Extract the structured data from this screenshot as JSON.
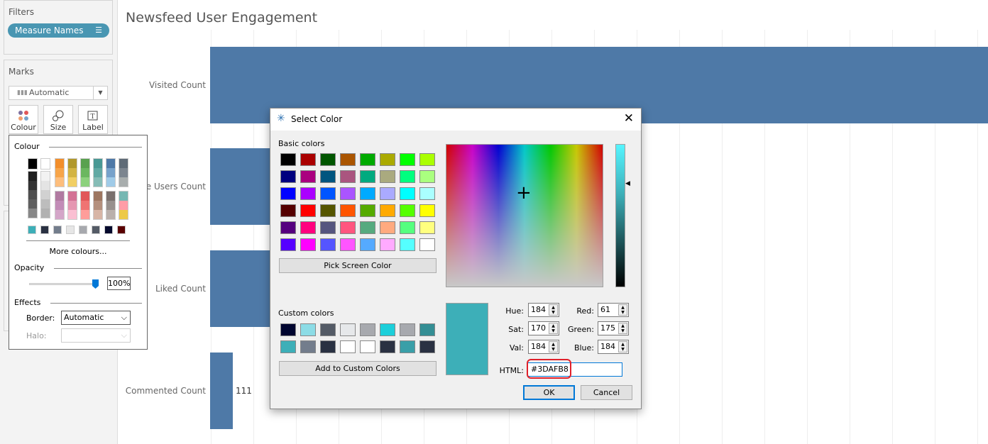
{
  "filters": {
    "title": "Filters",
    "pill": "Measure Names",
    "pill_icon": "sort-icon"
  },
  "marks": {
    "title": "Marks",
    "type": "Automatic",
    "buttons": [
      {
        "label": "Colour",
        "icon": "colour-dots-icon"
      },
      {
        "label": "Size",
        "icon": "size-icon"
      },
      {
        "label": "Label",
        "icon": "label-icon"
      }
    ]
  },
  "colour_popup": {
    "title": "Colour",
    "more": "More colours...",
    "opacity_title": "Opacity",
    "opacity_value": "100%",
    "opacity_level": 100,
    "effects_title": "Effects",
    "border_label": "Border:",
    "border_value": "Automatic",
    "halo_label": "Halo:",
    "halo_value": "",
    "top_columns": [
      [
        "#000000"
      ],
      [
        "#ffffff"
      ],
      [
        "#f28e2b",
        "#f7a54a",
        "#fdbe7d"
      ],
      [
        "#b1982c",
        "#d3b443",
        "#f1cf64"
      ],
      [
        "#59a14f",
        "#6bb760",
        "#8cd17d"
      ],
      [
        "#499894",
        "#62a9a4",
        "#86bcb6"
      ],
      [
        "#4e79a7",
        "#77a2cb",
        "#a0cbe8"
      ],
      [
        "#5f6b77",
        "#7c858f",
        "#a8adad"
      ]
    ],
    "gray_columns": [
      [
        "#1f1f1f",
        "#333333",
        "#4f4f4f",
        "#5f5f5f",
        "#878787"
      ],
      [
        "#f2f2f2",
        "#e4e4e4",
        "#d1d1d1",
        "#bdbdbd",
        "#b1b1b1"
      ]
    ],
    "mid_columns": [
      [
        "#b07aa1",
        "#c28cb7",
        "#d4a6c8"
      ],
      [
        "#d37295",
        "#e597b2",
        "#fabfd2"
      ],
      [
        "#e15759",
        "#ef7373",
        "#ff9d9a"
      ],
      [
        "#9d7660",
        "#b4907d",
        "#d7b5a6"
      ],
      [
        "#79706e",
        "#97908d",
        "#bab0ac"
      ],
      [
        "#76b7b2",
        "#ff9da7",
        "#edc948"
      ]
    ],
    "recent": [
      "#3dafb8",
      "#2a3142",
      "#737d8c",
      "#e6e6e6",
      "#a7a9ae",
      "#545b66",
      "#050a2d",
      "#5a0000"
    ]
  },
  "chart": {
    "title": "Newsfeed User Engagement"
  },
  "chart_data": {
    "type": "bar",
    "orientation": "horizontal",
    "title": "Newsfeed User Engagement",
    "categories": [
      "Visited Count",
      "...ve Users Count",
      "Liked Count",
      "Commented Count"
    ],
    "values": [
      null,
      null,
      null,
      111
    ],
    "data_labels": [
      "",
      "",
      "",
      "111"
    ],
    "bar_color": "#4e79a7",
    "grid": true
  },
  "dialog": {
    "title": "Select Color",
    "close_icon": "close-icon",
    "basic_label": "Basic colors",
    "basic": [
      "#000000",
      "#aa0000",
      "#005500",
      "#aa5500",
      "#00aa00",
      "#aaaa00",
      "#00ff00",
      "#aaff00",
      "#00007f",
      "#aa007f",
      "#00557f",
      "#aa557f",
      "#00aa7f",
      "#aaaa7f",
      "#00ff7f",
      "#aaff7f",
      "#0000ff",
      "#aa00ff",
      "#0055ff",
      "#aa55ff",
      "#00aaff",
      "#aaaaff",
      "#00ffff",
      "#aaffff",
      "#550000",
      "#ff0000",
      "#555500",
      "#ff5500",
      "#55aa00",
      "#ffaa00",
      "#55ff00",
      "#ffff00",
      "#55007f",
      "#ff007f",
      "#55557f",
      "#ff557f",
      "#55aa7f",
      "#ffaa7f",
      "#55ff7f",
      "#ffff7f",
      "#5500ff",
      "#ff00ff",
      "#5555ff",
      "#ff55ff",
      "#55aaff",
      "#ffaaff",
      "#55ffff",
      "#ffffff"
    ],
    "pick_screen": "Pick Screen Color",
    "custom_label": "Custom colors",
    "custom": [
      "#000530",
      "#8cdce6",
      "#545b66",
      "#e6e8ea",
      "#a7a9ae",
      "#1ccfda",
      "#a7a9ae",
      "#348e94",
      "#3dafb8",
      "#737d8c",
      "#2a3142",
      "#ffffff",
      "#ffffff",
      "#2a3142",
      "#3a9fa8",
      "#2a3142"
    ],
    "add_custom": "Add to Custom Colors",
    "current_color": "#3dafb8",
    "fields": {
      "hue_label": "Hue:",
      "hue": "184",
      "sat_label": "Sat:",
      "sat": "170",
      "val_label": "Val:",
      "val": "184",
      "red_label": "Red:",
      "red": "61",
      "green_label": "Green:",
      "green": "175",
      "blue_label": "Blue:",
      "blue": "184"
    },
    "html_label": "HTML:",
    "html_value": "#3DAFB8",
    "ok": "OK",
    "cancel": "Cancel"
  }
}
